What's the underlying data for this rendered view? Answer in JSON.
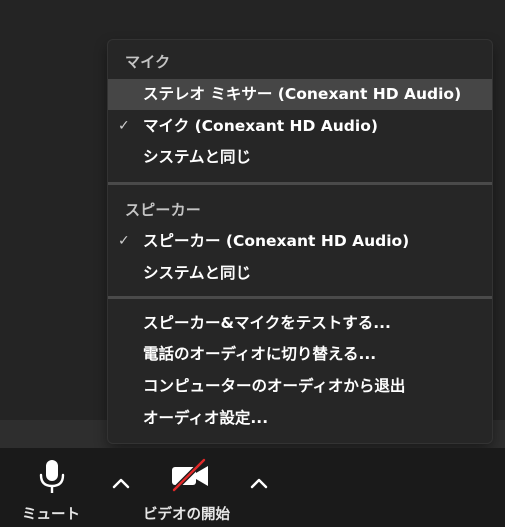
{
  "menu": {
    "sections": [
      {
        "header": "マイク",
        "items": [
          {
            "label": "ステレオ ミキサー (Conexant HD Audio)",
            "checked": false,
            "highlighted": true
          },
          {
            "label": "マイク (Conexant HD Audio)",
            "checked": true,
            "highlighted": false
          },
          {
            "label": "システムと同じ",
            "checked": false,
            "highlighted": false
          }
        ]
      },
      {
        "header": "スピーカー",
        "items": [
          {
            "label": "スピーカー (Conexant HD Audio)",
            "checked": true,
            "highlighted": false
          },
          {
            "label": "システムと同じ",
            "checked": false,
            "highlighted": false
          }
        ]
      },
      {
        "header": "",
        "items": [
          {
            "label": "スピーカー&マイクをテストする...",
            "checked": false,
            "highlighted": false
          },
          {
            "label": "電話のオーディオに切り替える...",
            "checked": false,
            "highlighted": false
          },
          {
            "label": "コンピューターのオーディオから退出",
            "checked": false,
            "highlighted": false
          },
          {
            "label": "オーディオ設定...",
            "checked": false,
            "highlighted": false
          }
        ]
      }
    ],
    "check_glyph": "✓"
  },
  "toolbar": {
    "mute_label": "ミュート",
    "video_label": "ビデオの開始",
    "mic_icon": "microphone-icon",
    "video_icon": "video-off-icon",
    "chevron_icon": "chevron-up-icon"
  },
  "colors": {
    "menu_bg": "#262626",
    "highlight_bg": "#464646",
    "toolbar_bg": "#1a1a1a",
    "video_off_slash": "#e02828"
  }
}
